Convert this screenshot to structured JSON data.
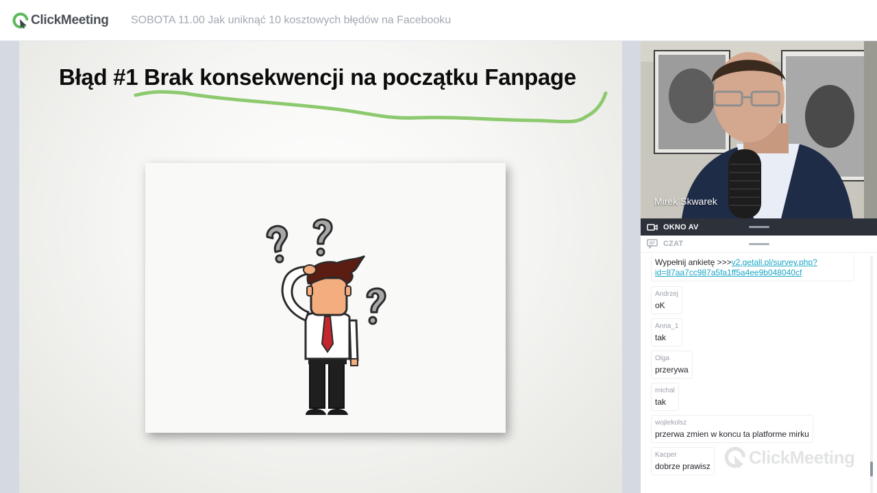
{
  "app": {
    "logo_text": "ClickMeeting",
    "event_title": "SOBOTA 11.00 Jak uniknąć 10 kosztowych błędów na Facebooku"
  },
  "slide": {
    "title": "Błąd #1 Brak konsekwencji na początku Fanpage",
    "underline_color": "#8dc96e"
  },
  "video": {
    "presenter_name": "Mirek Skwarek"
  },
  "panels": {
    "av_label": "OKNO AV",
    "chat_label": "CZAT"
  },
  "chat": {
    "first_message_prefix": "Wypełnij ankietę >>>",
    "first_message_link": "v2.getall.pl/survey.php?id=87aa7cc987a5fa1ff5a4ee9b048040cf",
    "messages": [
      {
        "author": "Andrzej",
        "text": "oK"
      },
      {
        "author": "Anna_1",
        "text": "tak"
      },
      {
        "author": "Olga",
        "text": "przerywa"
      },
      {
        "author": "michal",
        "text": "tak"
      },
      {
        "author": "wojtekolsz",
        "text": "przerwa zmien w koncu ta platforme mirku"
      },
      {
        "author": "Kacper",
        "text": "dobrze prawisz"
      }
    ],
    "watermark_text": "ClickMeeting"
  },
  "colors": {
    "brand_green": "#5cb85c",
    "link": "#1aa6c6",
    "panel_dark": "#2d313a"
  }
}
